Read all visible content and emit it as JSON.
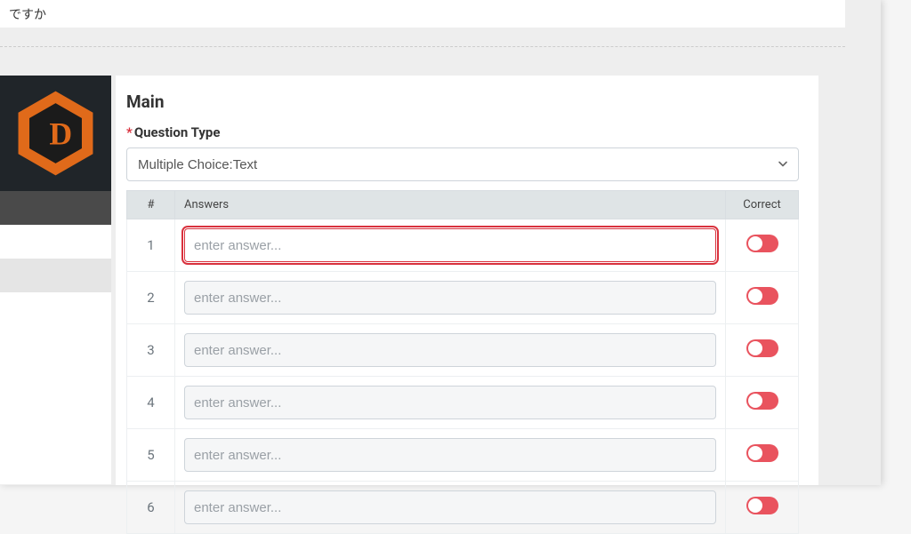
{
  "top": {
    "text": "ですか"
  },
  "main": {
    "title": "Main",
    "question_type": {
      "label": "Question Type",
      "required_mark": "*",
      "selected": "Multiple Choice:Text"
    },
    "table": {
      "headers": {
        "num": "#",
        "answers": "Answers",
        "correct": "Correct"
      },
      "placeholder": "enter answer...",
      "rows": [
        {
          "num": "1",
          "value": "",
          "focused": true,
          "correct_on": false
        },
        {
          "num": "2",
          "value": "",
          "focused": false,
          "correct_on": false
        },
        {
          "num": "3",
          "value": "",
          "focused": false,
          "correct_on": false
        },
        {
          "num": "4",
          "value": "",
          "focused": false,
          "correct_on": false
        },
        {
          "num": "5",
          "value": "",
          "focused": false,
          "correct_on": false
        },
        {
          "num": "6",
          "value": "",
          "focused": false,
          "correct_on": false
        }
      ]
    }
  },
  "logo": {
    "letter": "D"
  },
  "colors": {
    "accent": "#e06a1a",
    "danger": "#e9535e",
    "focus": "#d9313d"
  }
}
